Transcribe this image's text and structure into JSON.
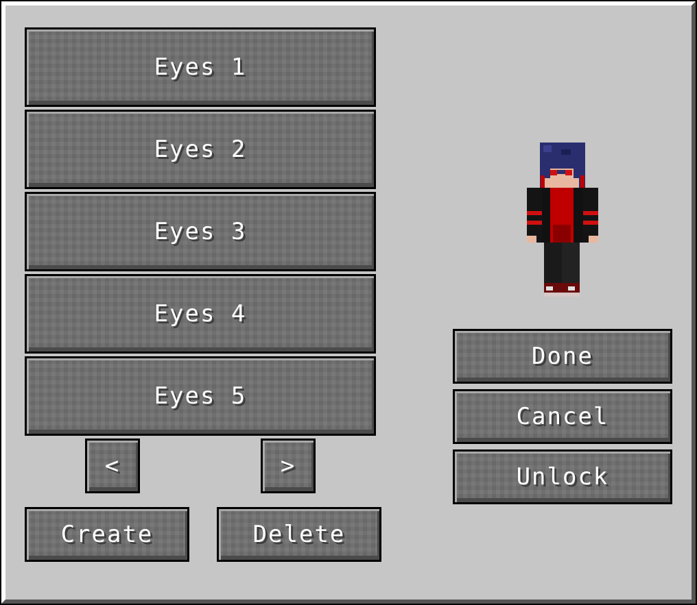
{
  "list": {
    "items": [
      {
        "label": "Eyes 1"
      },
      {
        "label": "Eyes 2"
      },
      {
        "label": "Eyes 3"
      },
      {
        "label": "Eyes 4"
      },
      {
        "label": "Eyes 5"
      }
    ]
  },
  "pager": {
    "prev_label": "<",
    "next_label": ">"
  },
  "actions": {
    "create_label": "Create",
    "delete_label": "Delete",
    "done_label": "Done",
    "cancel_label": "Cancel",
    "unlock_label": "Unlock"
  },
  "preview": {
    "icon": "player-skin-icon",
    "colors": {
      "hair": "#2a2e6e",
      "skin": "#e8b8a0",
      "jacket": "#111111",
      "shirt": "#c00000",
      "accent": "#d01010",
      "pants": "#1a1a1a",
      "shoes": "#6a0a0a"
    }
  }
}
